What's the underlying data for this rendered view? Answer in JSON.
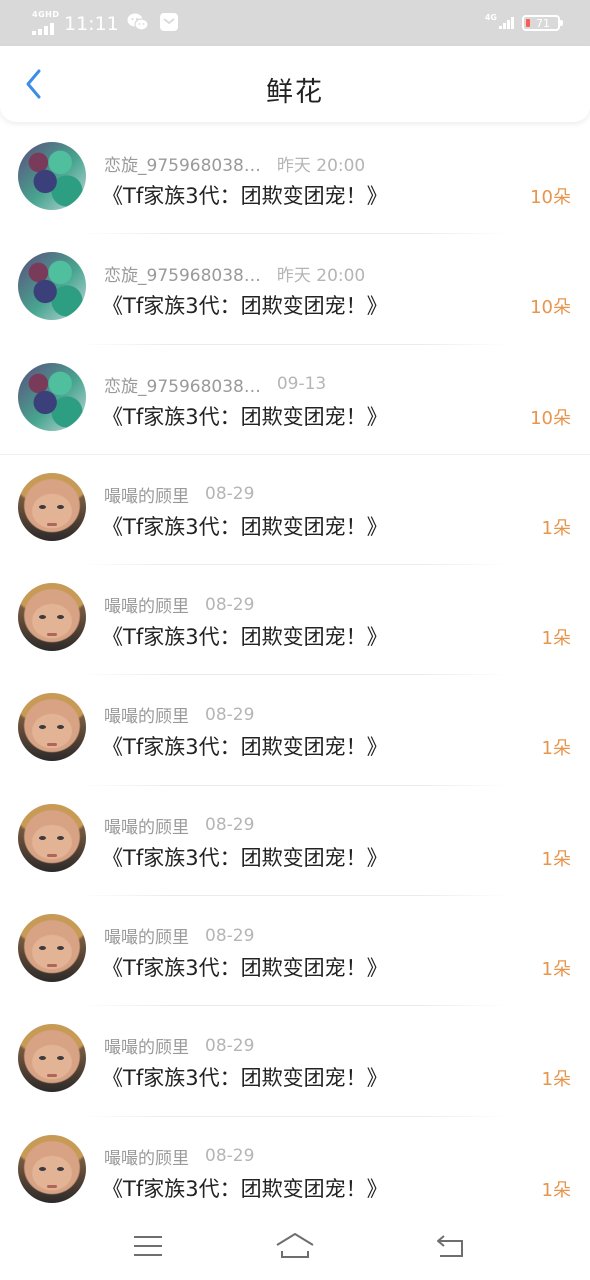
{
  "status_bar": {
    "time": "11:11",
    "network_left": "4GHD",
    "network_right": "4G",
    "battery": "71",
    "icons": [
      "signal-icon",
      "wechat-icon",
      "mail-icon",
      "signal-icon",
      "battery-icon"
    ]
  },
  "header": {
    "title": "鲜花",
    "back_icon": "chevron-left-icon"
  },
  "flowers": [
    {
      "user": "恋旋_975968038…",
      "time": "昨天 20:00",
      "book": "《Tf家族3代：团欺变团宠！》",
      "count": "10朵",
      "avatar": "anime"
    },
    {
      "user": "恋旋_975968038…",
      "time": "昨天 20:00",
      "book": "《Tf家族3代：团欺变团宠！》",
      "count": "10朵",
      "avatar": "anime"
    },
    {
      "user": "恋旋_975968038…",
      "time": "09-13",
      "book": "《Tf家族3代：团欺变团宠！》",
      "count": "10朵",
      "avatar": "anime"
    },
    {
      "user": "嘬嘬的顾里",
      "time": "08-29",
      "book": "《Tf家族3代：团欺变团宠！》",
      "count": "1朵",
      "avatar": "child"
    },
    {
      "user": "嘬嘬的顾里",
      "time": "08-29",
      "book": "《Tf家族3代：团欺变团宠！》",
      "count": "1朵",
      "avatar": "child"
    },
    {
      "user": "嘬嘬的顾里",
      "time": "08-29",
      "book": "《Tf家族3代：团欺变团宠！》",
      "count": "1朵",
      "avatar": "child"
    },
    {
      "user": "嘬嘬的顾里",
      "time": "08-29",
      "book": "《Tf家族3代：团欺变团宠！》",
      "count": "1朵",
      "avatar": "child"
    },
    {
      "user": "嘬嘬的顾里",
      "time": "08-29",
      "book": "《Tf家族3代：团欺变团宠！》",
      "count": "1朵",
      "avatar": "child"
    },
    {
      "user": "嘬嘬的顾里",
      "time": "08-29",
      "book": "《Tf家族3代：团欺变团宠！》",
      "count": "1朵",
      "avatar": "child"
    },
    {
      "user": "嘬嘬的顾里",
      "time": "08-29",
      "book": "《Tf家族3代：团欺变团宠！》",
      "count": "1朵",
      "avatar": "child"
    }
  ],
  "nav_bar": {
    "icons": [
      "menu-icon",
      "home-icon",
      "back-icon"
    ]
  },
  "colors": {
    "accent": "#3a8ee6",
    "count": "#e8954c",
    "status_bar": "#d9d9d9",
    "battery_low": "#ff5a5a"
  }
}
